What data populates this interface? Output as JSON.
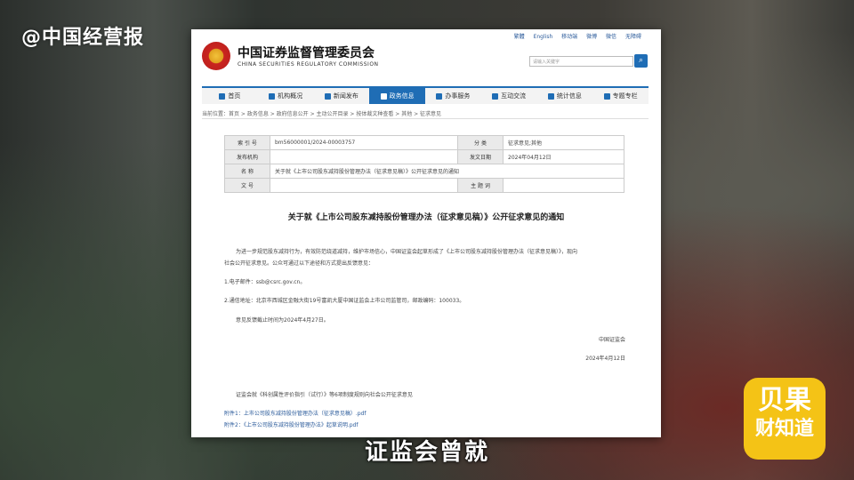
{
  "overlay": {
    "watermark": "@中国经营报",
    "badge_line1": "贝果",
    "badge_line2": "财知道",
    "subtitle": "证监会曾就"
  },
  "site": {
    "top_links": [
      "繁體",
      "English",
      "移动端",
      "微博",
      "微信",
      "无障碍"
    ],
    "name_cn": "中国证券监督管理委员会",
    "name_en": "CHINA SECURITIES REGULATORY COMMISSION",
    "search_placeholder": "请输入关键字"
  },
  "nav": {
    "items": [
      "首页",
      "机构概况",
      "新闻发布",
      "政务信息",
      "办事服务",
      "互动交流",
      "统计信息",
      "专题专栏"
    ],
    "active_index": 3
  },
  "breadcrumb": "当前位置：首页 > 政务信息 > 政府信息公开 > 主动公开目录 > 按体裁文种查看 > 其他 > 征求意见",
  "meta": {
    "rows": [
      [
        "索 引 号",
        "bm56000001/2024-00003757",
        "分    类",
        "征求意见;其他"
      ],
      [
        "发布机构",
        "",
        "发文日期",
        "2024年04月12日"
      ],
      [
        "名    称",
        "关于就《上市公司股东减持股份管理办法（征求意见稿）》公开征求意见的通知",
        "",
        ""
      ],
      [
        "文    号",
        "",
        "主 题 词",
        ""
      ]
    ]
  },
  "doc": {
    "title": "关于就《上市公司股东减持股份管理办法（征求意见稿）》公开征求意见的通知",
    "para1_line1": "为进一步规范股东减持行为，有效防范绕道减持，维护市场信心，中国证监会起草形成了《上市公司股东减持股份管理办法（征求意见稿）》，现向",
    "para1_line2": "社会公开征求意见。公众可通过以下途径和方式提出反馈意见：",
    "email": "1.电子邮件：ssb@csrc.gov.cn。",
    "address": "2.通信地址：北京市西城区金融大街19号富凯大厦中国证监会上市公司监管司，邮政编码：100033。",
    "deadline": "意见反馈截止时间为2024年4月27日。",
    "signer": "中国证监会",
    "date": "2024年4月12日",
    "related": "证监会就《科创属性评价指引（试行）》等6项制度规则向社会公开征求意见",
    "attachment1": "附件1：上市公司股东减持股份管理办法（征求意见稿）.pdf",
    "attachment2": "附件2：《上市公司股东减持股份管理办法》起草说明.pdf"
  },
  "colors": {
    "accent": "#1f6db5",
    "badge": "#f4c316"
  }
}
